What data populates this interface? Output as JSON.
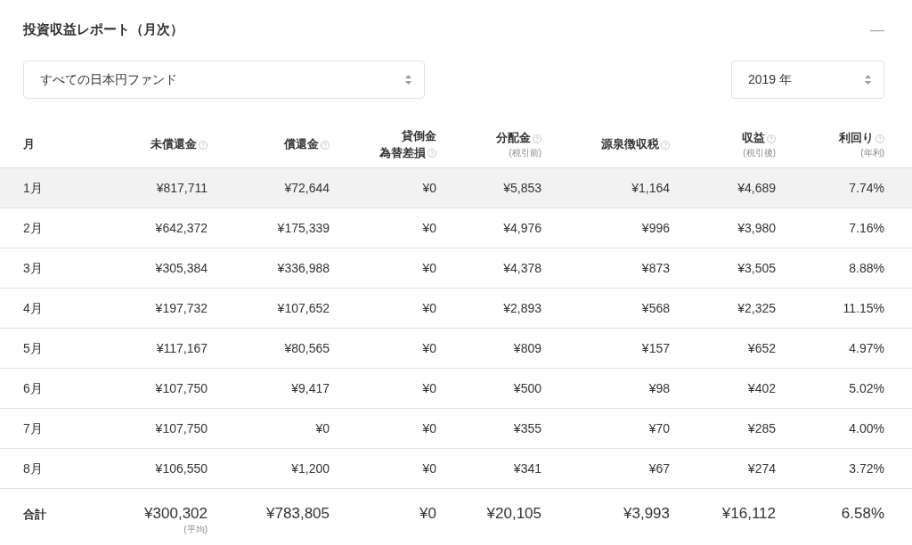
{
  "title": "投資収益レポート（月次）",
  "collapse": {
    "label": "—"
  },
  "fund_select": {
    "value": "すべての日本円ファンド"
  },
  "year_select": {
    "value": "2019 年"
  },
  "table": {
    "columns": [
      {
        "lines": [
          "月"
        ],
        "help": false
      },
      {
        "lines": [
          "未償還金"
        ],
        "help": true
      },
      {
        "lines": [
          "償還金"
        ],
        "help": true
      },
      {
        "lines": [
          "貸倒金",
          "為替差損"
        ],
        "help": true
      },
      {
        "lines": [
          "分配金"
        ],
        "help": true,
        "note": "(税引前)"
      },
      {
        "lines": [
          "源泉徴収税"
        ],
        "help": true
      },
      {
        "lines": [
          "収益"
        ],
        "help": true,
        "note": "(税引後)"
      },
      {
        "lines": [
          "利回り"
        ],
        "help": true,
        "note": "(年利)"
      }
    ],
    "rows": [
      {
        "selected": true,
        "cells": [
          "1月",
          "¥817,711",
          "¥72,644",
          "¥0",
          "¥5,853",
          "¥1,164",
          "¥4,689",
          "7.74%"
        ]
      },
      {
        "selected": false,
        "cells": [
          "2月",
          "¥642,372",
          "¥175,339",
          "¥0",
          "¥4,976",
          "¥996",
          "¥3,980",
          "7.16%"
        ]
      },
      {
        "selected": false,
        "cells": [
          "3月",
          "¥305,384",
          "¥336,988",
          "¥0",
          "¥4,378",
          "¥873",
          "¥3,505",
          "8.88%"
        ]
      },
      {
        "selected": false,
        "cells": [
          "4月",
          "¥197,732",
          "¥107,652",
          "¥0",
          "¥2,893",
          "¥568",
          "¥2,325",
          "11.15%"
        ]
      },
      {
        "selected": false,
        "cells": [
          "5月",
          "¥117,167",
          "¥80,565",
          "¥0",
          "¥809",
          "¥157",
          "¥652",
          "4.97%"
        ]
      },
      {
        "selected": false,
        "cells": [
          "6月",
          "¥107,750",
          "¥9,417",
          "¥0",
          "¥500",
          "¥98",
          "¥402",
          "5.02%"
        ]
      },
      {
        "selected": false,
        "cells": [
          "7月",
          "¥107,750",
          "¥0",
          "¥0",
          "¥355",
          "¥70",
          "¥285",
          "4.00%"
        ]
      },
      {
        "selected": false,
        "cells": [
          "8月",
          "¥106,550",
          "¥1,200",
          "¥0",
          "¥341",
          "¥67",
          "¥274",
          "3.72%"
        ]
      }
    ],
    "total": {
      "cells": [
        "合計",
        "¥300,302",
        "¥783,805",
        "¥0",
        "¥20,105",
        "¥3,993",
        "¥16,112",
        "6.58%"
      ],
      "notes": {
        "1": "(平均)"
      }
    }
  }
}
